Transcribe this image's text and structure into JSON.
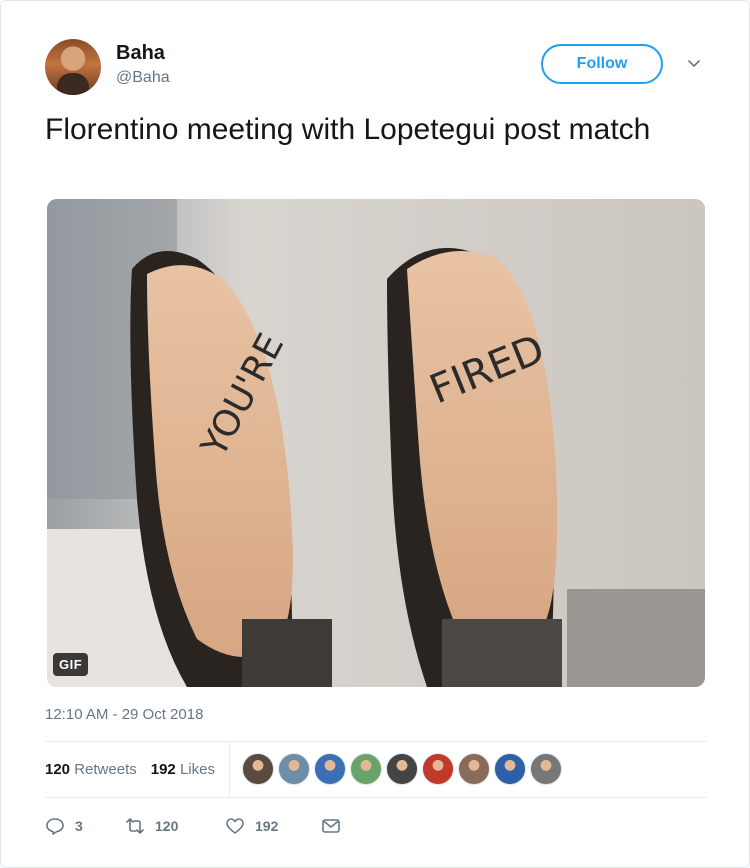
{
  "user": {
    "display_name": "Baha",
    "handle": "@Baha",
    "follow_label": "Follow"
  },
  "tweet": {
    "text": "Florentino meeting with Lopetegui post match",
    "media": {
      "badge": "GIF",
      "left_sole_text": "YOU'RE",
      "right_sole_text": "FIRED"
    },
    "timestamp": "12:10 AM - 29 Oct 2018"
  },
  "stats": {
    "retweets_count": "120",
    "retweets_label": "Retweets",
    "likes_count": "192",
    "likes_label": "Likes",
    "liker_avatar_colors": [
      "#5a4a40",
      "#6f8ca8",
      "#3b6fb3",
      "#6aa36a",
      "#444444",
      "#c0392b",
      "#8a6a5a",
      "#2f5fa8",
      "#777777"
    ]
  },
  "actions": {
    "reply_count": "3",
    "retweet_count": "120",
    "like_count": "192"
  },
  "colors": {
    "accent": "#1da1f2",
    "secondary_text": "#657786",
    "divider": "#e6ecf0"
  }
}
